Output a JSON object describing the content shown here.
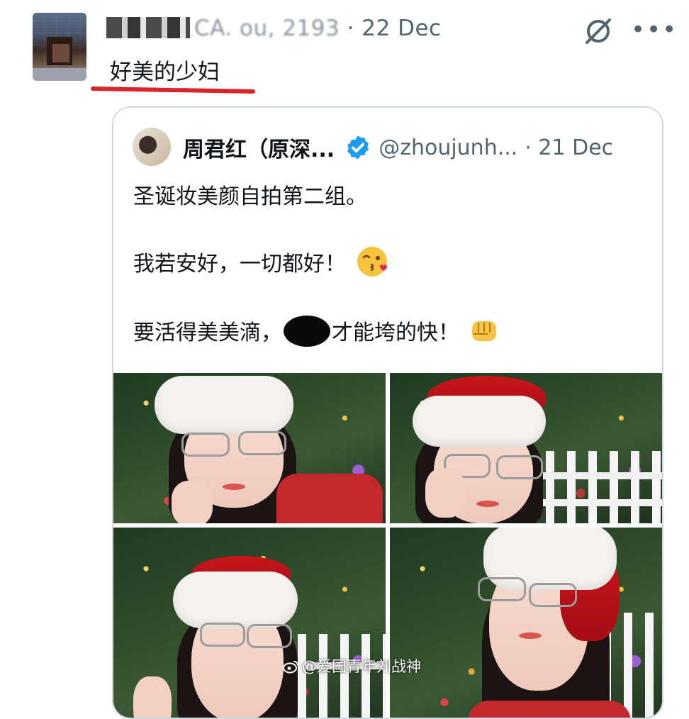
{
  "post": {
    "handle_fragment": "CA. ou, 2193",
    "date": "· 22 Dec",
    "text": "好美的少妇"
  },
  "quoted": {
    "name": "周君红（原深...",
    "handle": "@zhoujunh...",
    "date": "· 21 Dec",
    "lines": [
      "圣诞妆美颜自拍第二组。",
      "我若安好，一切都好！",
      "要活得美美滴，",
      "才能垮的快！"
    ]
  },
  "icons": [
    "avatar",
    "grok-icon",
    "more-icon",
    "verified-badge-icon",
    "kiss-emoji-icon",
    "fist-emoji-icon",
    "weibo-icon"
  ],
  "colors": {
    "accent_underline": "#d8252a",
    "verified": "#1d9bf0",
    "meta_text": "#536471"
  },
  "watermark": "@爱国青年刘战神"
}
